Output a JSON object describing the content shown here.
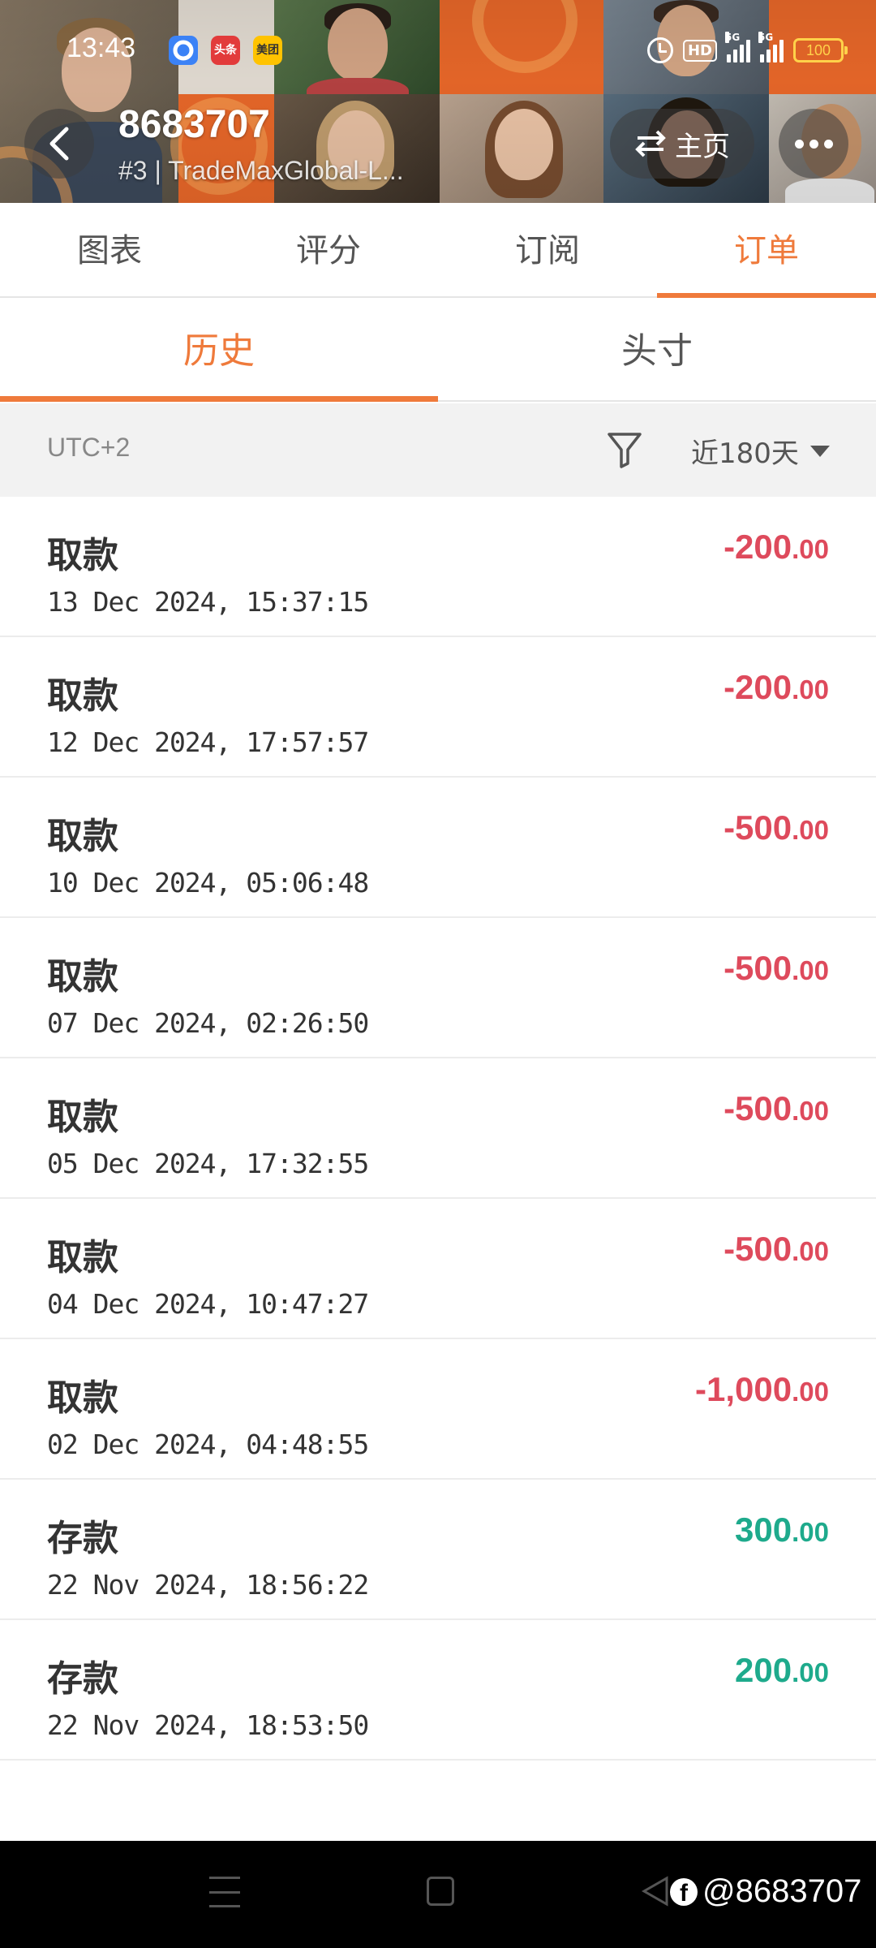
{
  "status_bar": {
    "time": "13:43",
    "app_badges": [
      "",
      "头条",
      "美团"
    ],
    "hd": "HD",
    "signal_tags": [
      "5G",
      "5G"
    ],
    "battery": "100"
  },
  "header": {
    "account_number": "8683707",
    "subtitle": "#3 | TradeMaxGlobal-L...",
    "home_label": "主页"
  },
  "main_tabs": [
    {
      "label": "图表",
      "active": false
    },
    {
      "label": "评分",
      "active": false
    },
    {
      "label": "订阅",
      "active": false
    },
    {
      "label": "订单",
      "active": true
    }
  ],
  "sub_tabs": [
    {
      "label": "历史",
      "active": true
    },
    {
      "label": "头寸",
      "active": false
    }
  ],
  "filter": {
    "timezone": "UTC+2",
    "period": "近180天"
  },
  "transactions": [
    {
      "type": "取款",
      "datetime": "13 Dec 2024, 15:37:15",
      "amount_int": "-200",
      "amount_dec": ".00",
      "direction": "negative"
    },
    {
      "type": "取款",
      "datetime": "12 Dec 2024, 17:57:57",
      "amount_int": "-200",
      "amount_dec": ".00",
      "direction": "negative"
    },
    {
      "type": "取款",
      "datetime": "10 Dec 2024, 05:06:48",
      "amount_int": "-500",
      "amount_dec": ".00",
      "direction": "negative"
    },
    {
      "type": "取款",
      "datetime": "07 Dec 2024, 02:26:50",
      "amount_int": "-500",
      "amount_dec": ".00",
      "direction": "negative"
    },
    {
      "type": "取款",
      "datetime": "05 Dec 2024, 17:32:55",
      "amount_int": "-500",
      "amount_dec": ".00",
      "direction": "negative"
    },
    {
      "type": "取款",
      "datetime": "04 Dec 2024, 10:47:27",
      "amount_int": "-500",
      "amount_dec": ".00",
      "direction": "negative"
    },
    {
      "type": "取款",
      "datetime": "02 Dec 2024, 04:48:55",
      "amount_int": "-1,000",
      "amount_dec": ".00",
      "direction": "negative"
    },
    {
      "type": "存款",
      "datetime": "22 Nov 2024, 18:56:22",
      "amount_int": "300",
      "amount_dec": ".00",
      "direction": "positive"
    },
    {
      "type": "存款",
      "datetime": "22 Nov 2024, 18:53:50",
      "amount_int": "200",
      "amount_dec": ".00",
      "direction": "positive"
    }
  ],
  "watermark": "@8683707",
  "colors": {
    "accent": "#ef7a3b",
    "negative": "#de4a5c",
    "positive": "#1eaa8c"
  }
}
